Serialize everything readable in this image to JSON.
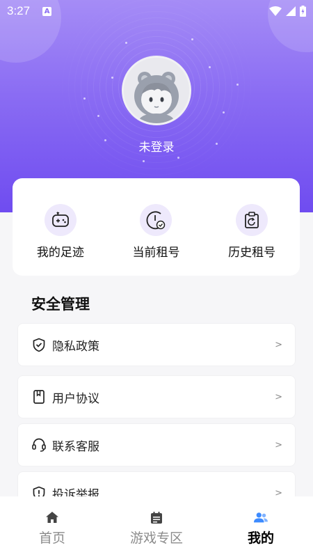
{
  "status_bar": {
    "time": "3:27",
    "indicator": "A"
  },
  "profile": {
    "login_label": "未登录"
  },
  "quick_actions": [
    {
      "label": "我的足迹",
      "icon": "gamepad-icon"
    },
    {
      "label": "当前租号",
      "icon": "clock-check-icon"
    },
    {
      "label": "历史租号",
      "icon": "clipboard-refresh-icon"
    }
  ],
  "security": {
    "title": "安全管理",
    "items": [
      {
        "label": "隐私政策",
        "icon": "shield-check-icon",
        "arrow": ">"
      },
      {
        "label": "用户协议",
        "icon": "document-icon",
        "arrow": ">"
      },
      {
        "label": "联系客服",
        "icon": "headset-icon",
        "arrow": ">"
      },
      {
        "label": "投诉举报",
        "icon": "shield-alert-icon",
        "arrow": ">"
      }
    ]
  },
  "tabbar": {
    "tabs": [
      {
        "label": "首页",
        "icon": "home-icon",
        "active": false
      },
      {
        "label": "游戏专区",
        "icon": "calendar-icon",
        "active": false
      },
      {
        "label": "我的",
        "icon": "users-icon",
        "active": true
      }
    ]
  },
  "colors": {
    "accent": "#6f4cf0",
    "active_tab_icon": "#3d8bff",
    "icon_bg": "#eee9fc"
  }
}
